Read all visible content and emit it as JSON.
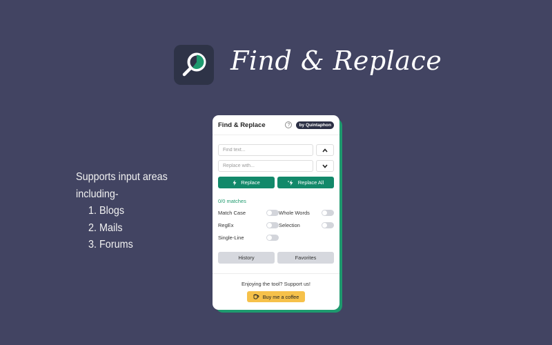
{
  "header": {
    "app_title": "Find & Replace",
    "logo_icon": "magnifier-icon"
  },
  "features": {
    "intro_line1": "Supports input areas",
    "intro_line2": "including-",
    "items": [
      "1. Blogs",
      "2. Mails",
      "3. Forums"
    ]
  },
  "panel": {
    "title": "Find & Replace",
    "help_icon_text": "?",
    "badge": "by Quintaphon",
    "find_placeholder": "Find text...",
    "replace_placeholder": "Replace with...",
    "replace_label": "Replace",
    "replace_all_label": "Replace All",
    "matches_text": "0/0 matches",
    "options": {
      "match_case": "Match Case",
      "whole_words": "Whole Words",
      "regex": "RegEx",
      "selection": "Selection",
      "single_line": "Single-Line"
    },
    "history_label": "History",
    "favorites_label": "Favorites",
    "support_text": "Enjoying the tool? Support us!",
    "coffee_label": "Buy me a coffee"
  },
  "colors": {
    "background": "#424462",
    "accent_green": "#12896a",
    "coffee_yellow": "#f6c14a"
  }
}
